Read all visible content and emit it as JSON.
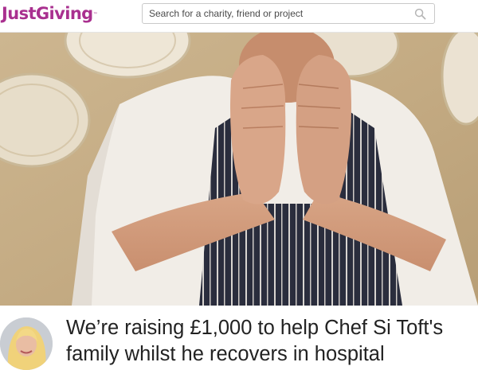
{
  "header": {
    "logo_text": "JustGiving",
    "logo_mark": "™",
    "search": {
      "placeholder": "Search for a charity, friend or project",
      "icon": "search-icon"
    }
  },
  "colors": {
    "brand": "#a9308f",
    "title_text": "#222222"
  },
  "hero": {
    "subject": "chef-in-striped-apron-covering-face-photo"
  },
  "fundraiser": {
    "title": "We’re raising £1,000 to help Chef Si Toft's family whilst he recovers in hospital",
    "avatar": "fundraiser-avatar"
  }
}
